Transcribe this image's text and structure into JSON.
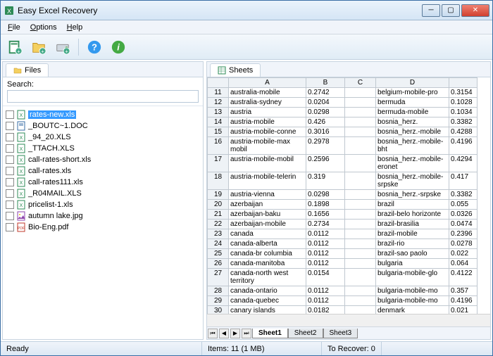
{
  "window": {
    "title": "Easy Excel Recovery"
  },
  "menu": {
    "file": "File",
    "options": "Options",
    "help": "Help"
  },
  "tabs": {
    "files": "Files",
    "sheets": "Sheets"
  },
  "search": {
    "label": "Search:",
    "value": ""
  },
  "files": [
    {
      "name": "rates-new.xls",
      "type": "xls",
      "selected": true
    },
    {
      "name": "_BOUTC~1.DOC",
      "type": "doc"
    },
    {
      "name": "_94_20.XLS",
      "type": "xls"
    },
    {
      "name": "_TTACH.XLS",
      "type": "xls"
    },
    {
      "name": "call-rates-short.xls",
      "type": "xls"
    },
    {
      "name": "call-rates.xls",
      "type": "xls"
    },
    {
      "name": "call-rates111.xls",
      "type": "xls"
    },
    {
      "name": "_R04MAIL.XLS",
      "type": "xls"
    },
    {
      "name": "pricelist-1.xls",
      "type": "xls"
    },
    {
      "name": "autumn lake.jpg",
      "type": "jpg"
    },
    {
      "name": "Bio-Eng.pdf",
      "type": "pdf"
    }
  ],
  "sheet": {
    "cols": [
      "A",
      "B",
      "C",
      "D",
      ""
    ],
    "rows": [
      {
        "n": "11",
        "a": "australia-mobile",
        "b": "0.2742",
        "c": "",
        "d": "belgium-mobile-pro",
        "e": "0.3154"
      },
      {
        "n": "12",
        "a": "australia-sydney",
        "b": "0.0204",
        "c": "",
        "d": "bermuda",
        "e": "0.1028"
      },
      {
        "n": "13",
        "a": "austria",
        "b": "0.0298",
        "c": "",
        "d": "bermuda-mobile",
        "e": "0.1034"
      },
      {
        "n": "14",
        "a": "austria-mobile",
        "b": "0.426",
        "c": "",
        "d": "bosnia_herz.",
        "e": "0.3382"
      },
      {
        "n": "15",
        "a": "austria-mobile-conne",
        "b": "0.3016",
        "c": "",
        "d": "bosnia_herz.-mobile",
        "e": "0.4288"
      },
      {
        "n": "16",
        "a": "austria-mobile-max mobil",
        "b": "0.2978",
        "c": "",
        "d": "bosnia_herz.-mobile-bht",
        "e": "0.4196"
      },
      {
        "n": "17",
        "a": "austria-mobile-mobil",
        "b": "0.2596",
        "c": "",
        "d": "bosnia_herz.-mobile-eronet",
        "e": "0.4294"
      },
      {
        "n": "18",
        "a": "austria-mobile-telerin",
        "b": "0.319",
        "c": "",
        "d": "bosnia_herz.-mobile-srpske",
        "e": "0.417"
      },
      {
        "n": "19",
        "a": "austria-vienna",
        "b": "0.0298",
        "c": "",
        "d": "bosnia_herz.-srpske",
        "e": "0.3382"
      },
      {
        "n": "20",
        "a": "azerbaijan",
        "b": "0.1898",
        "c": "",
        "d": "brazil",
        "e": "0.055"
      },
      {
        "n": "21",
        "a": "azerbaijan-baku",
        "b": "0.1656",
        "c": "",
        "d": "brazil-belo horizonte",
        "e": "0.0326"
      },
      {
        "n": "22",
        "a": "azerbaijan-mobile",
        "b": "0.2734",
        "c": "",
        "d": "brazil-brasilia",
        "e": "0.0474"
      },
      {
        "n": "23",
        "a": "canada",
        "b": "0.0112",
        "c": "",
        "d": "brazil-mobile",
        "e": "0.2396"
      },
      {
        "n": "24",
        "a": "canada-alberta",
        "b": "0.0112",
        "c": "",
        "d": "brazil-rio",
        "e": "0.0278"
      },
      {
        "n": "25",
        "a": "canada-br columbia",
        "b": "0.0112",
        "c": "",
        "d": "brazil-sao paolo",
        "e": "0.022"
      },
      {
        "n": "26",
        "a": "canada-manitoba",
        "b": "0.0112",
        "c": "",
        "d": "bulgaria",
        "e": "0.064"
      },
      {
        "n": "27",
        "a": "canada-north west territory",
        "b": "0.0154",
        "c": "",
        "d": "bulgaria-mobile-glo",
        "e": "0.4122"
      },
      {
        "n": "28",
        "a": "canada-ontario",
        "b": "0.0112",
        "c": "",
        "d": "bulgaria-mobile-mo",
        "e": "0.357"
      },
      {
        "n": "29",
        "a": "canada-quebec",
        "b": "0.0112",
        "c": "",
        "d": "bulgaria-mobile-mo",
        "e": "0.4196"
      },
      {
        "n": "30",
        "a": "canary islands",
        "b": "0.0182",
        "c": "",
        "d": "denmark",
        "e": "0.021"
      }
    ],
    "tabs": [
      "Sheet1",
      "Sheet2",
      "Sheet3"
    ]
  },
  "status": {
    "ready": "Ready",
    "items": "Items: 11 (1 MB)",
    "recover": "To Recover: 0"
  }
}
